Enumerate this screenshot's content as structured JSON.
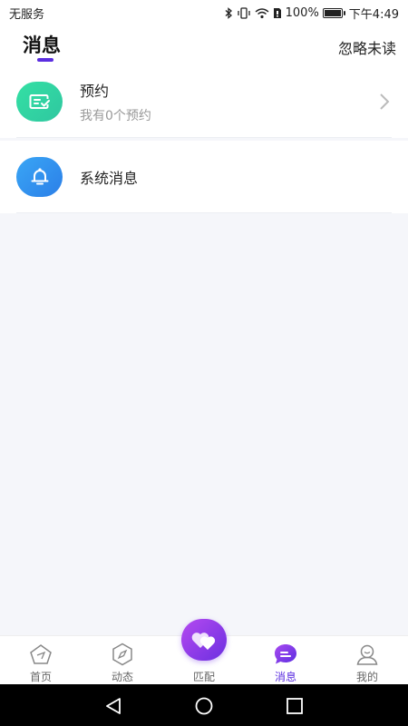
{
  "status_bar": {
    "carrier": "无服务",
    "battery_text": "100%",
    "battery_level": 1.0,
    "time": "下午4:49",
    "icons": [
      "bluetooth-icon",
      "vibrate-icon",
      "wifi-icon",
      "sim-icon",
      "battery-icon"
    ]
  },
  "header": {
    "title": "消息",
    "ignore_unread": "忽略未读",
    "accent_color": "#5b2ee0"
  },
  "messages": [
    {
      "title": "预约",
      "subtitle": "我有0个预约",
      "icon": "appointment-ticket-icon",
      "icon_color": "#2fd3a2",
      "has_chevron": true
    },
    {
      "title": "系统消息",
      "subtitle": "",
      "icon": "bell-icon",
      "icon_color": "#3394f0",
      "has_chevron": false
    }
  ],
  "bottom_nav": {
    "items": [
      {
        "label": "首页",
        "icon": "home-pentagon-icon",
        "active": false
      },
      {
        "label": "动态",
        "icon": "compass-icon",
        "active": false
      },
      {
        "label": "匹配",
        "icon": "hearts-icon",
        "active": false
      },
      {
        "label": "消息",
        "icon": "message-bubble-icon",
        "active": true
      },
      {
        "label": "我的",
        "icon": "profile-icon",
        "active": false
      }
    ]
  },
  "system_nav": {
    "buttons": [
      "back-icon",
      "home-icon",
      "recents-icon"
    ]
  }
}
